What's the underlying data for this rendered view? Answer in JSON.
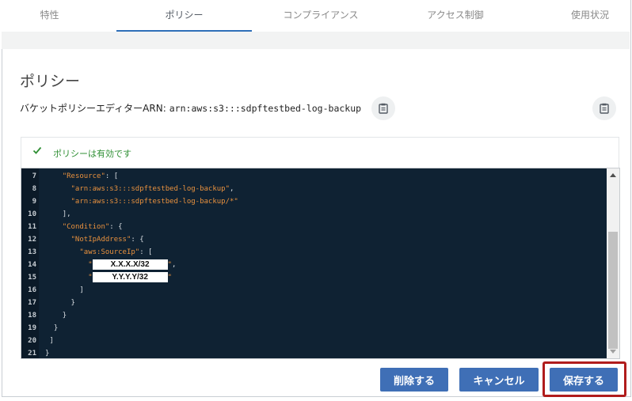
{
  "tabs": [
    {
      "label": "特性"
    },
    {
      "label": "ポリシー"
    },
    {
      "label": "コンプライアンス"
    },
    {
      "label": "アクセス制御"
    },
    {
      "label": "使用状況"
    }
  ],
  "page": {
    "title": "ポリシー",
    "editor_label": "バケットポリシーエディター",
    "arn_label": "ARN:",
    "arn_value": "arn:aws:s3:::sdpftestbed-log-backup"
  },
  "validation": {
    "message": "ポリシーは有効です",
    "icon": "check-icon",
    "color": "#2f8f34"
  },
  "editor": {
    "lines": [
      {
        "n": "7",
        "indent": "    ",
        "parts": [
          {
            "t": "\"Resource\"",
            "c": "key"
          },
          {
            "t": ": [",
            "c": "pun"
          }
        ]
      },
      {
        "n": "8",
        "indent": "      ",
        "parts": [
          {
            "t": "\"arn:aws:s3:::sdpftestbed-log-backup\"",
            "c": "str"
          },
          {
            "t": ",",
            "c": "pun"
          }
        ]
      },
      {
        "n": "9",
        "indent": "      ",
        "parts": [
          {
            "t": "\"arn:aws:s3:::sdpftestbed-log-backup/*\"",
            "c": "str"
          }
        ]
      },
      {
        "n": "10",
        "indent": "    ",
        "parts": [
          {
            "t": "],",
            "c": "pun"
          }
        ]
      },
      {
        "n": "11",
        "indent": "    ",
        "parts": [
          {
            "t": "\"Condition\"",
            "c": "key"
          },
          {
            "t": ": {",
            "c": "pun"
          }
        ]
      },
      {
        "n": "12",
        "indent": "      ",
        "parts": [
          {
            "t": "\"NotIpAddress\"",
            "c": "key"
          },
          {
            "t": ": {",
            "c": "pun"
          }
        ]
      },
      {
        "n": "13",
        "indent": "        ",
        "parts": [
          {
            "t": "\"aws:SourceIp\"",
            "c": "key"
          },
          {
            "t": ": [",
            "c": "pun"
          }
        ]
      },
      {
        "n": "14",
        "indent": "          ",
        "parts": [
          {
            "t": "\"",
            "c": "str"
          },
          {
            "t": "X.X.X.X/32",
            "c": "mask"
          },
          {
            "t": "\"",
            "c": "str"
          },
          {
            "t": ",",
            "c": "pun"
          }
        ]
      },
      {
        "n": "15",
        "indent": "          ",
        "parts": [
          {
            "t": "\"",
            "c": "str"
          },
          {
            "t": "Y.Y.Y.Y/32",
            "c": "mask"
          },
          {
            "t": "\"",
            "c": "str"
          }
        ]
      },
      {
        "n": "16",
        "indent": "        ",
        "parts": [
          {
            "t": "]",
            "c": "pun"
          }
        ]
      },
      {
        "n": "17",
        "indent": "      ",
        "parts": [
          {
            "t": "}",
            "c": "pun"
          }
        ]
      },
      {
        "n": "18",
        "indent": "    ",
        "parts": [
          {
            "t": "}",
            "c": "pun"
          }
        ]
      },
      {
        "n": "19",
        "indent": "  ",
        "parts": [
          {
            "t": "}",
            "c": "pun"
          }
        ]
      },
      {
        "n": "20",
        "indent": " ",
        "parts": [
          {
            "t": "]",
            "c": "pun"
          }
        ]
      },
      {
        "n": "21",
        "indent": "",
        "parts": [
          {
            "t": "}",
            "c": "pun"
          }
        ]
      }
    ]
  },
  "buttons": {
    "delete": "削除する",
    "cancel": "キャンセル",
    "save": "保存する"
  },
  "colors": {
    "primary_button": "#3f6fb6",
    "active_tab_underline": "#2e6fb8",
    "highlight_border": "#b01c1c",
    "editor_bg": "#0f2233"
  }
}
